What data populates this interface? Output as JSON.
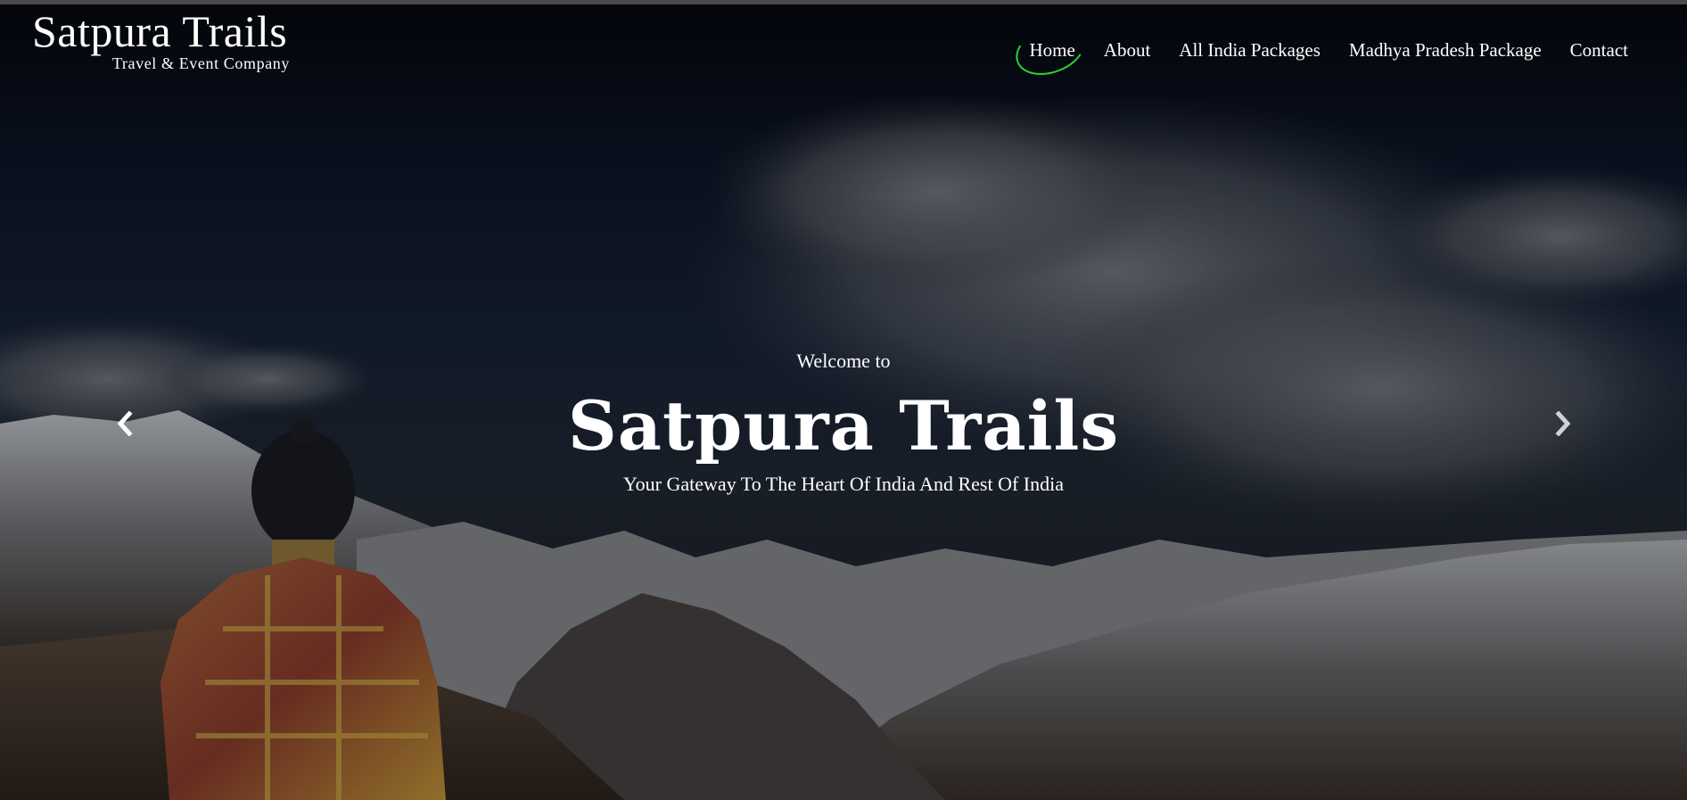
{
  "brand": {
    "title": "Satpura Trails",
    "subtitle": "Travel & Event Company"
  },
  "nav": {
    "items": [
      {
        "label": "Home",
        "active": true
      },
      {
        "label": "About",
        "active": false
      },
      {
        "label": "All India Packages",
        "active": false
      },
      {
        "label": "Madhya Pradesh Package",
        "active": false
      },
      {
        "label": "Contact",
        "active": false
      }
    ]
  },
  "hero": {
    "welcome": "Welcome to",
    "title": "Satpura Trails",
    "tagline": "Your Gateway To The Heart Of India And Rest Of India",
    "prev_icon": "chevron-left-icon",
    "next_icon": "chevron-right-icon"
  },
  "colors": {
    "active_nav_ring": "#2fd12f",
    "text": "#ffffff"
  }
}
